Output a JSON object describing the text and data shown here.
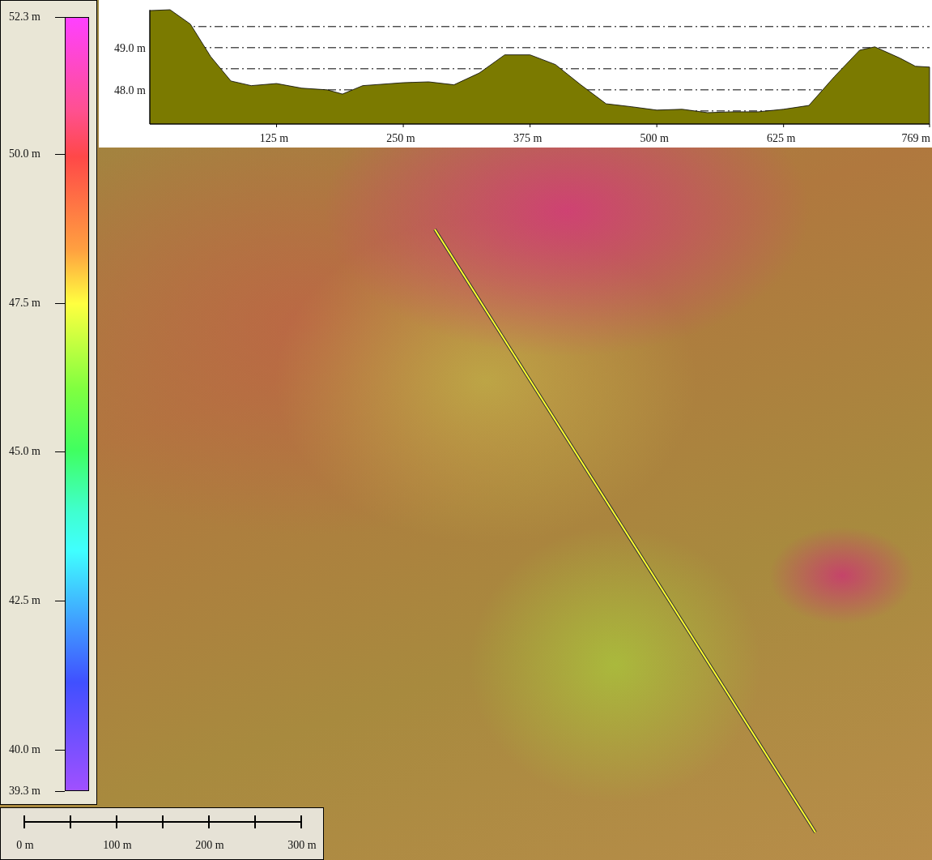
{
  "legend": {
    "labels": [
      "52.3 m",
      "50.0 m",
      "47.5 m",
      "45.0 m",
      "42.5 m",
      "40.0 m",
      "39.3 m"
    ]
  },
  "profile": {
    "chart_data": {
      "type": "area",
      "xlim": [
        0,
        769
      ],
      "ylim": [
        47.19,
        49.9
      ],
      "xticks": [
        {
          "value": 125,
          "label": "125 m"
        },
        {
          "value": 250,
          "label": "250 m"
        },
        {
          "value": 375,
          "label": "375 m"
        },
        {
          "value": 500,
          "label": "500 m"
        },
        {
          "value": 625,
          "label": "625 m"
        },
        {
          "value": 769,
          "label": "769 m"
        }
      ],
      "yticks": [
        {
          "value": 48,
          "label": "48.0 m"
        },
        {
          "value": 49,
          "label": "49.0 m"
        }
      ],
      "x": [
        0,
        20,
        40,
        60,
        80,
        100,
        125,
        150,
        175,
        190,
        210,
        250,
        275,
        300,
        325,
        350,
        375,
        400,
        425,
        450,
        475,
        500,
        525,
        550,
        575,
        600,
        625,
        650,
        675,
        700,
        715,
        740,
        755,
        769
      ],
      "series": [
        {
          "color": "#7b7a00",
          "values": [
            49.88,
            49.9,
            49.56,
            48.79,
            48.21,
            48.1,
            48.15,
            48.04,
            48.0,
            47.9,
            48.1,
            48.17,
            48.19,
            48.12,
            48.4,
            48.83,
            48.83,
            48.6,
            48.12,
            47.67,
            47.6,
            47.52,
            47.54,
            47.46,
            47.48,
            47.48,
            47.54,
            47.63,
            48.31,
            48.94,
            49.02,
            48.75,
            48.56,
            48.54
          ]
        }
      ]
    }
  },
  "scale_bar": {
    "labels": [
      "0 m",
      "100 m",
      "200 m",
      "300 m"
    ]
  }
}
